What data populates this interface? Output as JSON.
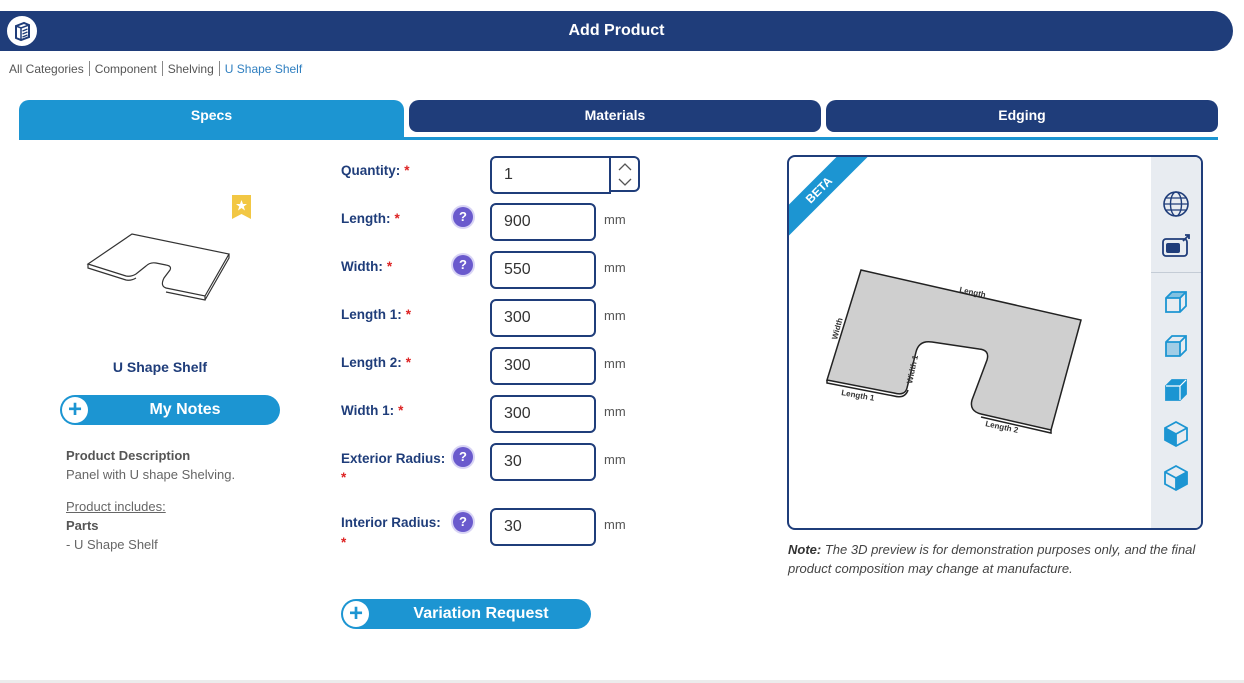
{
  "header": {
    "title": "Add Product",
    "logo": "box-logo-icon"
  },
  "breadcrumb": [
    "All Categories",
    "Component",
    "Shelving",
    "U Shape Shelf"
  ],
  "tabs": [
    {
      "label": "Specs",
      "active": true
    },
    {
      "label": "Materials",
      "active": false
    },
    {
      "label": "Edging",
      "active": false
    }
  ],
  "product": {
    "name": "U Shape Shelf",
    "notes_button": "My Notes",
    "description_heading": "Product Description",
    "description": "Panel with U shape Shelving.",
    "includes_heading": "Product includes:",
    "parts_heading": "Parts",
    "parts": [
      "- U Shape Shelf"
    ]
  },
  "form": {
    "required_mark": "*",
    "unit": "mm",
    "fields": [
      {
        "label": "Quantity:",
        "value": "1"
      },
      {
        "label": "Length:",
        "value": "900"
      },
      {
        "label": "Width:",
        "value": "550"
      },
      {
        "label": "Length 1:",
        "value": "300"
      },
      {
        "label": "Length 2:",
        "value": "300"
      },
      {
        "label": "Width 1:",
        "value": "300"
      },
      {
        "label": "Exterior Radius:",
        "value": "30"
      },
      {
        "label": "Interior Radius:",
        "value": "30"
      }
    ],
    "variation_button": "Variation Request"
  },
  "preview": {
    "badge": "BETA",
    "dimension_labels": [
      "Length",
      "Width",
      "Length 1",
      "Width 1",
      "Length 2"
    ],
    "tools": [
      "globe-icon",
      "screenshot-icon",
      "cube-top-view-icon",
      "cube-front-view-icon",
      "cube-side-view-icon",
      "cube-iso-view-icon",
      "cube-iso-alt-view-icon"
    ]
  },
  "note": {
    "bold": "Note:",
    "text": " The 3D preview is for demonstration purposes only, and the final product composition may change at manufacture."
  },
  "colors": {
    "navy": "#1f3d7a",
    "blue": "#1c95d2",
    "help": "#6a5acd",
    "required": "#d22222"
  }
}
